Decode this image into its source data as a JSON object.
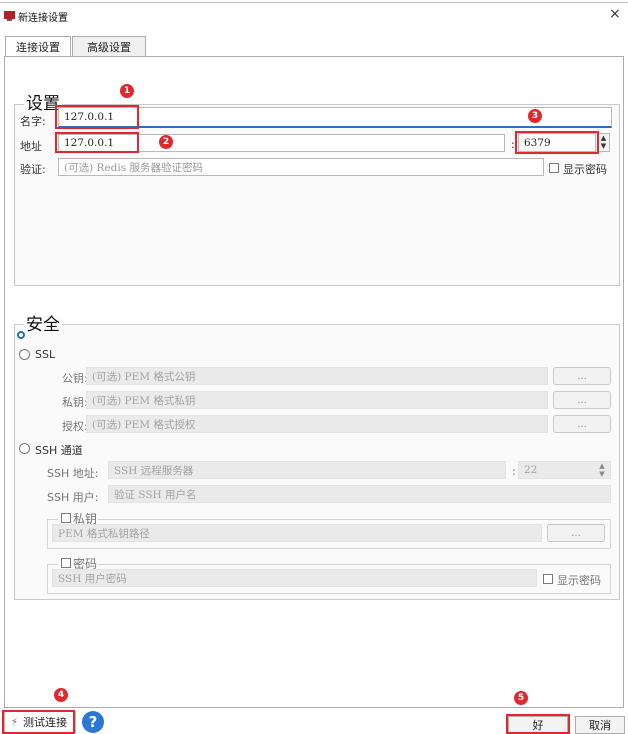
{
  "window": {
    "title": "新连接设置",
    "close_glyph": "×"
  },
  "tabs": [
    {
      "label": "连接设置"
    },
    {
      "label": "高级设置"
    }
  ],
  "settings": {
    "title": "设置",
    "name_label": "名字:",
    "name_value": "127.0.0.1",
    "address_label": "地址",
    "address_value": "127.0.0.1",
    "port_separator": ":",
    "port_value": "6379",
    "auth_label": "验证:",
    "auth_placeholder": "(可选) Redis 服务器验证密码",
    "show_password_label": "显示密码"
  },
  "security": {
    "title": "安全",
    "ssl_label": "SSL",
    "public_key_label": "公钥:",
    "public_key_placeholder": "(可选) PEM 格式公钥",
    "private_key_label": "私钥:",
    "private_key_placeholder": "(可选) PEM 格式私钥",
    "authority_label": "授权:",
    "authority_placeholder": "(可选) PEM 格式授权",
    "browse_label": "...",
    "ssh_label": "SSH 通道",
    "ssh_address_label": "SSH 地址:",
    "ssh_address_placeholder": "SSH 远程服务器",
    "ssh_port_separator": ":",
    "ssh_port_value": "22",
    "ssh_user_label": "SSH 用户:",
    "ssh_user_placeholder": "验证 SSH 用户名",
    "private_key_group_label": "私钥",
    "private_key_path_placeholder": "PEM 格式私钥路径",
    "password_group_label": "密码",
    "ssh_password_placeholder": "SSH 用户密码",
    "ssh_show_password_label": "显示密码"
  },
  "footer": {
    "test_connection_label": "测试连接",
    "help_glyph": "?",
    "ok_label": "好",
    "cancel_label": "取消"
  },
  "annotations": [
    "1",
    "2",
    "3",
    "4",
    "5"
  ],
  "colors": {
    "annotation": "#e0282e",
    "focus": "#2f6fb6",
    "help": "#2a78d6"
  }
}
